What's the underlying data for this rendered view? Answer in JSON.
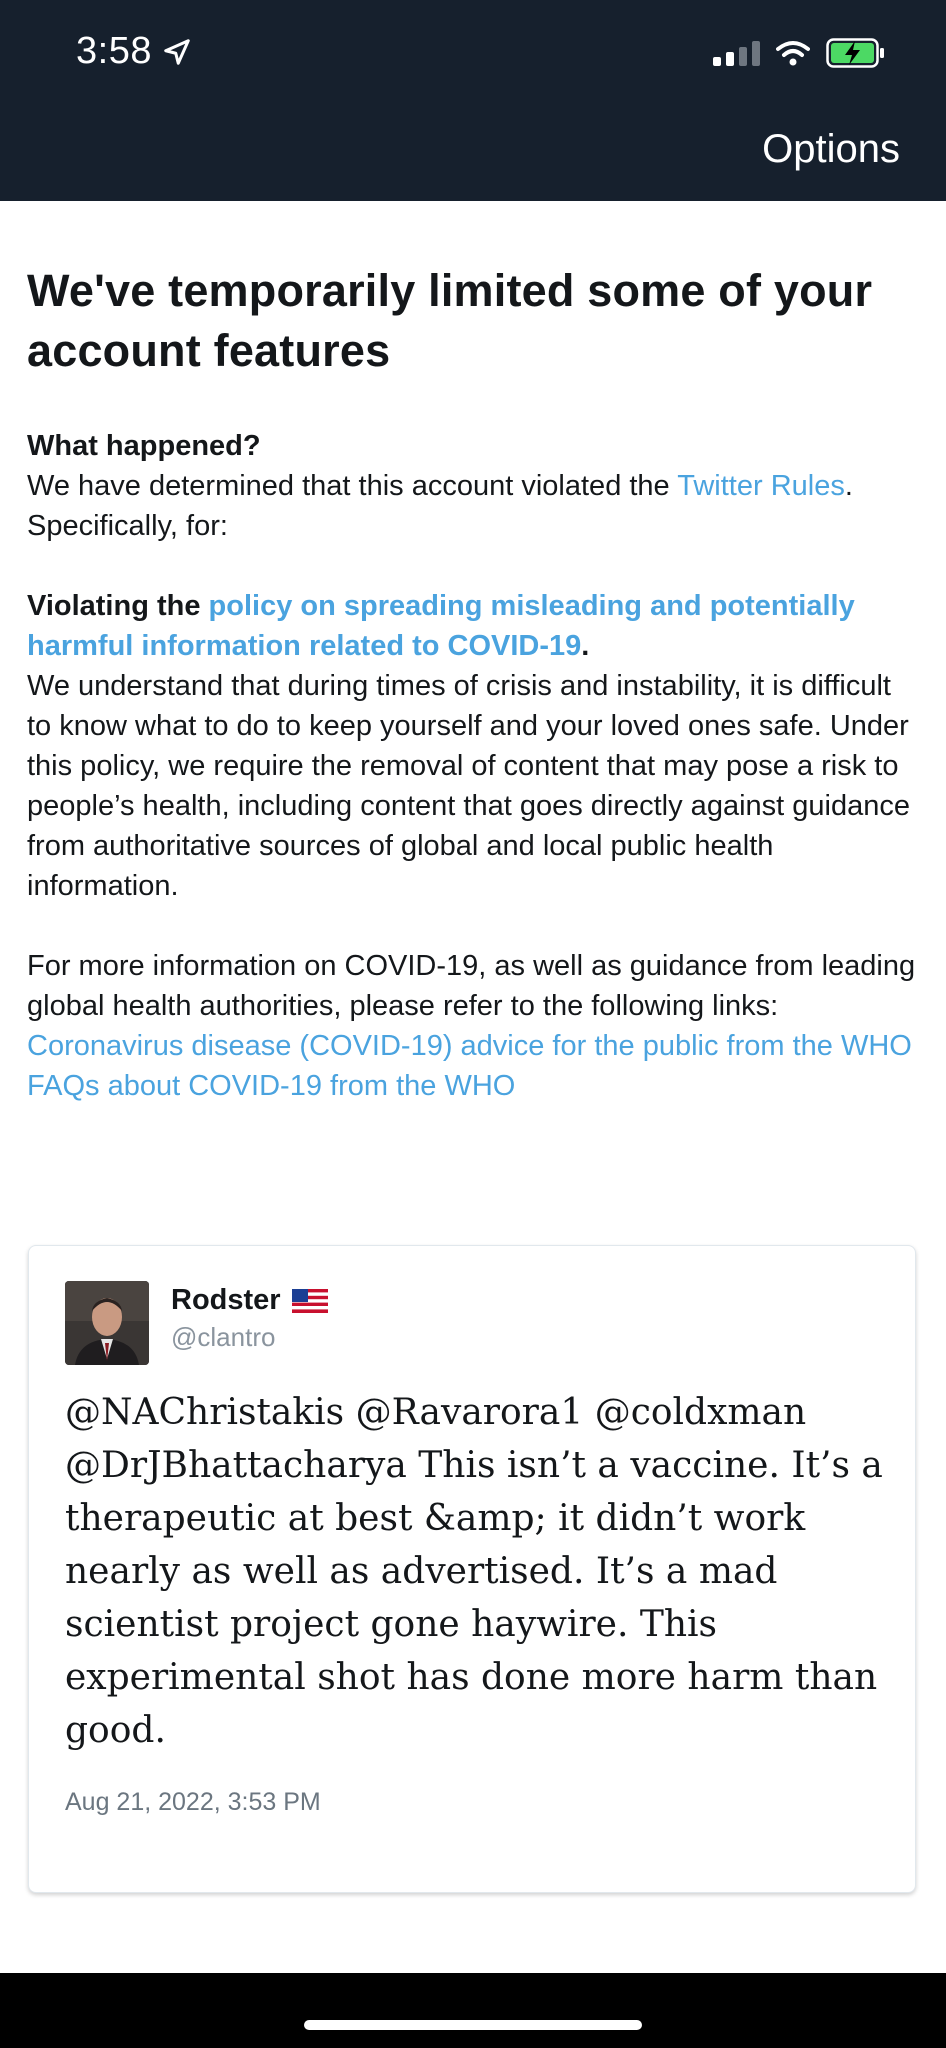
{
  "status_bar": {
    "time": "3:58"
  },
  "nav": {
    "options_label": "Options"
  },
  "notice": {
    "title": "We've temporarily limited some of your account features",
    "what_happened_heading": "What happened?",
    "determined_text": "We have determined that this account violated the ",
    "twitter_rules_link": "Twitter Rules",
    "determined_end": ".",
    "specifically": "Specifically, for:",
    "violating_prefix": "Violating the ",
    "policy_link": "policy on spreading misleading and potentially harmful information related to COVID-19",
    "policy_end": ".",
    "policy_explanation": "We understand that during times of crisis and instability, it is difficult to know what to do to keep yourself and your loved ones safe. Under this policy, we require the removal of content that may pose a risk to people’s health, including content that goes directly against guidance from authoritative sources of global and local public health information.",
    "more_info": "For more information on COVID-19, as well as guidance from leading global health authorities, please refer to the following links:",
    "who_advice_link": "Coronavirus disease (COVID-19) advice for the public from the WHO",
    "who_faq_link": "FAQs about COVID-19 from the WHO"
  },
  "tweet": {
    "author_name": "Rodster",
    "author_handle": "@clantro",
    "text": "@NAChristakis @Ravarora1 @coldxman @DrJBhattacharya This isn’t a vaccine. It’s a therapeutic at best &amp; it didn’t work nearly as well as advertised. It’s a mad scientist project gone haywire. This experimental shot has done more harm than good.",
    "timestamp": "Aug 21, 2022, 3:53 PM"
  },
  "colors": {
    "top_bar": "#16202d",
    "link": "#4aa3df",
    "text": "#14171a",
    "muted": "#8a949e"
  }
}
